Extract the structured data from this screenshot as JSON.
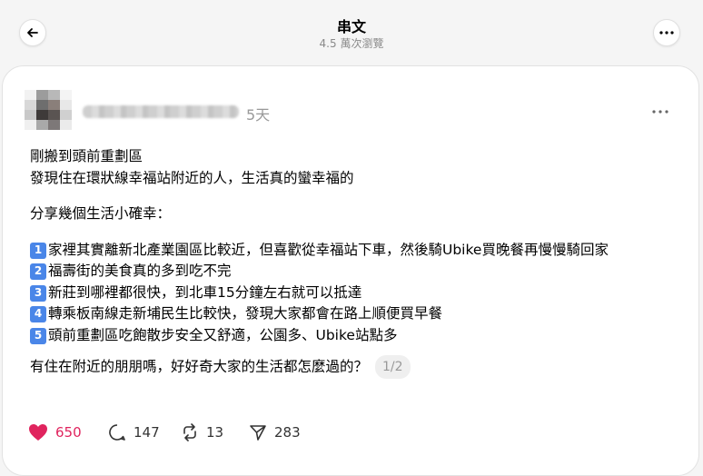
{
  "header": {
    "title": "串文",
    "subtitle": "4.5 萬次瀏覽"
  },
  "post": {
    "time": "5天",
    "lines": [
      "剛搬到頭前重劃區",
      "發現住在環狀線幸福站附近的人，生活真的蠻幸福的"
    ],
    "intro": "分享幾個生活小確幸：",
    "items": [
      {
        "num": "1",
        "text": "家裡其實離新北產業園區比較近，但喜歡從幸福站下車，然後騎Ubike買晚餐再慢慢騎回家"
      },
      {
        "num": "2",
        "text": "福壽街的美食真的多到吃不完"
      },
      {
        "num": "3",
        "text": "新莊到哪裡都很快，到北車15分鐘左右就可以抵達"
      },
      {
        "num": "4",
        "text": "轉乘板南線走新埔民生比較快，發現大家都會在路上順便買早餐"
      },
      {
        "num": "5",
        "text": "頭前重劃區吃飽散步安全又舒適，公園多、Ubike站點多"
      }
    ],
    "closing": "有住在附近的朋朋嗎，好好奇大家的生活都怎麼過的？",
    "page_indicator": "1/2"
  },
  "actions": {
    "likes": "650",
    "comments": "147",
    "reposts": "13",
    "shares": "283"
  },
  "colors": {
    "like": "#e0245e",
    "number_badge": "#4a86e8",
    "muted": "#999999"
  },
  "icons": [
    "back-arrow-icon",
    "more-icon",
    "heart-icon",
    "comment-icon",
    "repost-icon",
    "share-icon"
  ]
}
